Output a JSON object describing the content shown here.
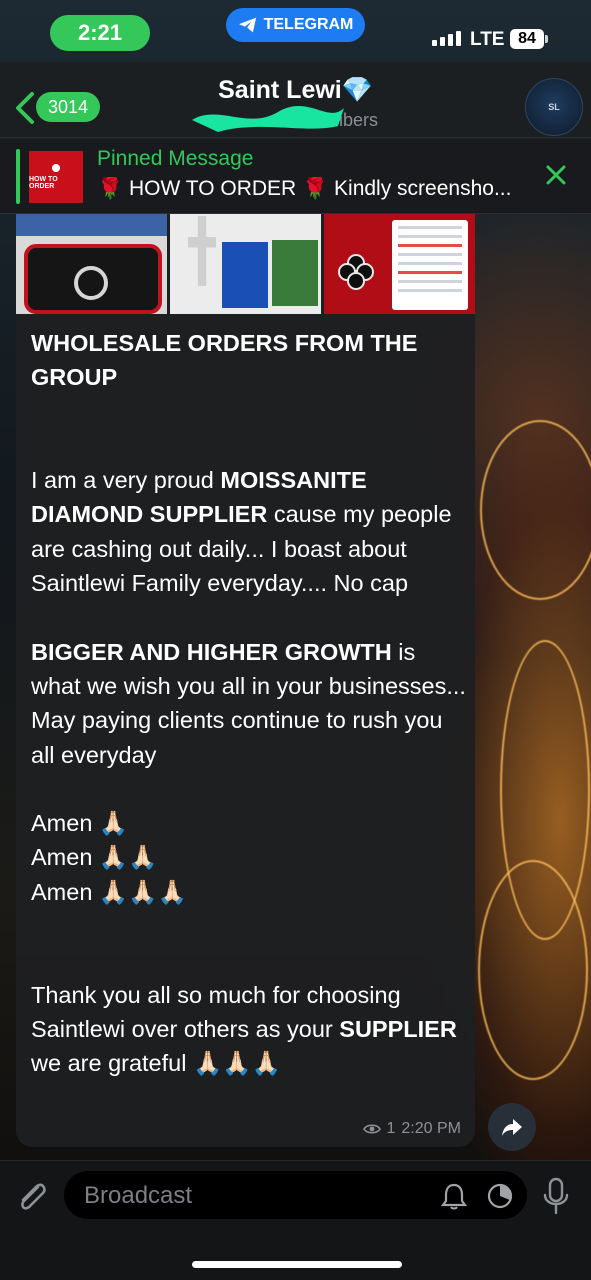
{
  "status_bar": {
    "time": "2:21",
    "app_pill": "TELEGRAM",
    "network": "LTE",
    "battery": "84"
  },
  "header": {
    "back_count": "3014",
    "title": "Saint Lewi💎",
    "subtitle": "ribers",
    "avatar_text": "SL"
  },
  "pinned": {
    "label": "Pinned Message",
    "text": "🌹 HOW TO ORDER 🌹 Kindly screensho...",
    "thumb_text": "HOW TO ORDER"
  },
  "message": {
    "heading": "WHOLESALE ORDERS FROM THE GROUP",
    "p1_pre": "I am a very proud ",
    "p1_bold": "MOISSANITE DIAMOND SUPPLIER",
    "p1_post": " cause my people are cashing out daily... I boast about Saintlewi Family everyday.... No cap",
    "p2_bold": "BIGGER AND HIGHER GROWTH",
    "p2_post": " is what we wish you all in your businesses... May paying clients continue to rush you all everyday",
    "amen1": "Amen 🙏🏻",
    "amen2": "Amen 🙏🏻🙏🏻",
    "amen3": "Amen 🙏🏻🙏🏻🙏🏻",
    "p3_pre": "Thank you all so much for choosing Saintlewi over others as your ",
    "p3_bold": "SUPPLIER",
    "p3_post": " we are grateful 🙏🏻🙏🏻🙏🏻",
    "views": "1",
    "time": "2:20 PM"
  },
  "composer": {
    "placeholder": "Broadcast"
  },
  "icons": [
    "telegram-icon",
    "back-chevron-icon",
    "close-icon",
    "eye-icon",
    "share-icon",
    "paperclip-icon",
    "bell-icon",
    "timer-icon",
    "mic-icon"
  ],
  "colors": {
    "accent": "#34c759",
    "telegram_blue": "#1e7cf2"
  }
}
